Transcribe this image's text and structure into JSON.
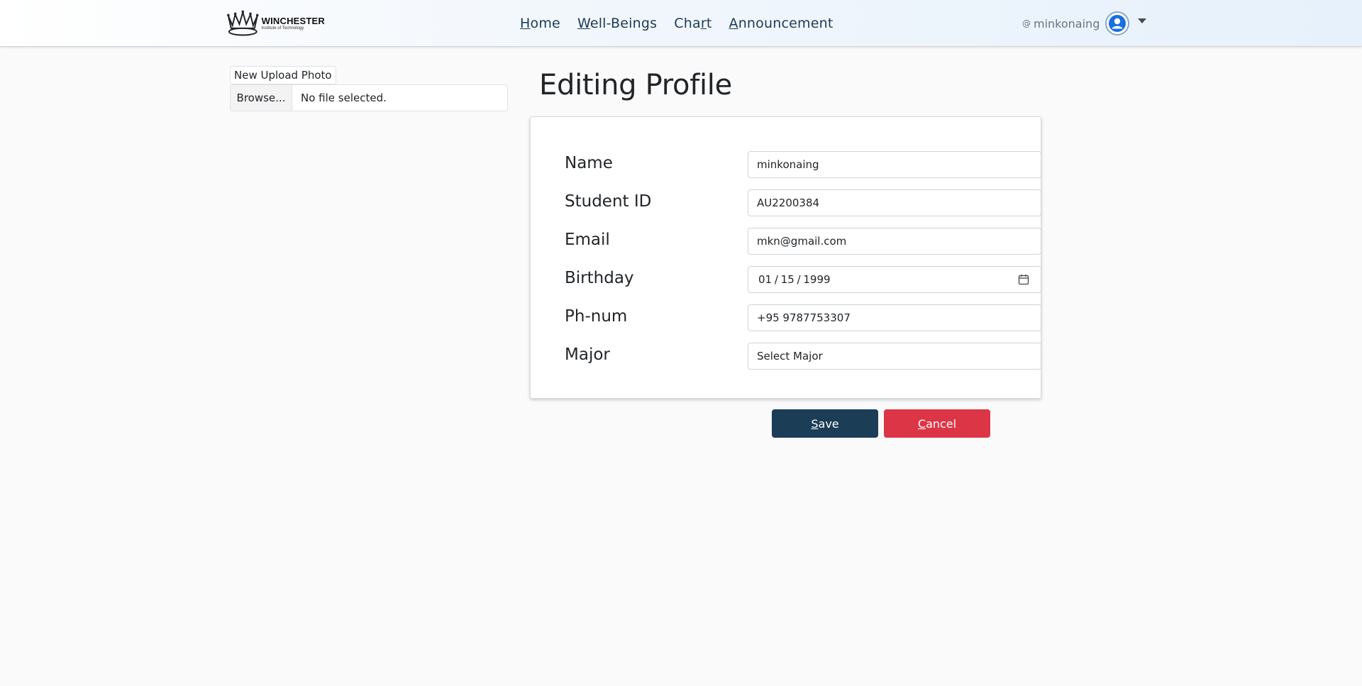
{
  "navbar": {
    "brand_name": "WINCHESTER",
    "brand_sub": "Institute of Technology",
    "links": [
      {
        "accel": "H",
        "rest": "ome"
      },
      {
        "accel": "W",
        "rest": "ell-Beings"
      },
      {
        "pre": "Cha",
        "accel": "r",
        "rest": "t"
      },
      {
        "accel": "A",
        "rest": "nnouncement"
      }
    ],
    "user": {
      "at": "@",
      "name": "minkonaing"
    }
  },
  "upload": {
    "label": "New Upload Photo",
    "browse": "Browse...",
    "status": "No file selected."
  },
  "page_title": "Editing Profile",
  "form": {
    "name": {
      "label": "Name",
      "value": "minkonaing"
    },
    "student_id": {
      "label": "Student ID",
      "value": "AU2200384"
    },
    "email": {
      "label": "Email",
      "value": "mkn@gmail.com"
    },
    "birthday": {
      "label": "Birthday",
      "value": "01 / 15 / 1999"
    },
    "phone": {
      "label": "Ph-num",
      "value": "+95 9787753307"
    },
    "major": {
      "label": "Major",
      "value": "Select Major"
    }
  },
  "buttons": {
    "save": {
      "accel": "S",
      "rest": "ave"
    },
    "cancel": {
      "accel": "C",
      "rest": "ancel"
    }
  },
  "colors": {
    "save": "#1b3d56",
    "cancel": "#dc3545",
    "nav_text": "#1b3b54",
    "avatar_blue": "#1a6fe0"
  }
}
